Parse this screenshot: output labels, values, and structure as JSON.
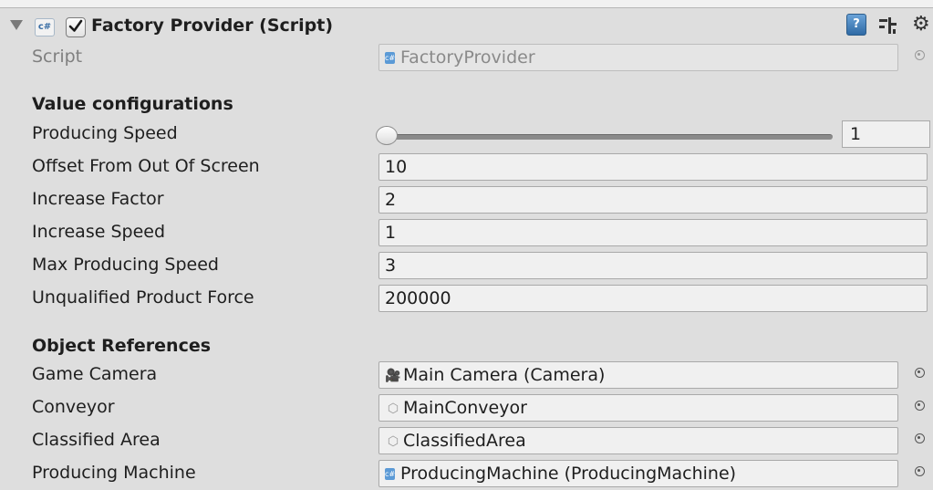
{
  "component": {
    "title": "Factory Provider (Script)",
    "enabled": true,
    "icons": {
      "script": "cs-script-icon",
      "help": "help-icon",
      "presets": "presets-icon",
      "settings": "gear-icon"
    },
    "cs_badge": "c#",
    "help_glyph": "?"
  },
  "script_row": {
    "label": "Script",
    "value": "FactoryProvider"
  },
  "value_section": {
    "heading": "Value configurations",
    "producing_speed": {
      "label": "Producing Speed",
      "value": "1",
      "slider_fraction": 0.0
    },
    "offset": {
      "label": "Offset From Out Of Screen",
      "value": "10"
    },
    "increase_factor": {
      "label": "Increase Factor",
      "value": "2"
    },
    "increase_speed": {
      "label": "Increase Speed",
      "value": "1"
    },
    "max_producing_speed": {
      "label": "Max Producing Speed",
      "value": "3"
    },
    "unqualified_force": {
      "label": "Unqualified Product Force",
      "value": "200000"
    }
  },
  "references_section": {
    "heading": "Object References",
    "game_camera": {
      "label": "Game Camera",
      "value": "Main Camera (Camera)",
      "icon": "camera-icon"
    },
    "conveyor": {
      "label": "Conveyor",
      "value": "MainConveyor",
      "icon": "gameobject-icon"
    },
    "classified_area": {
      "label": "Classified Area",
      "value": "ClassifiedArea",
      "icon": "gameobject-icon"
    },
    "producing_machine": {
      "label": "Producing Machine",
      "value": "ProducingMachine (ProducingMachine)",
      "icon": "script-icon"
    }
  },
  "colors": {
    "background": "#dedede",
    "field": "#f0f0f0",
    "help_blue": "#2f6aa5"
  }
}
